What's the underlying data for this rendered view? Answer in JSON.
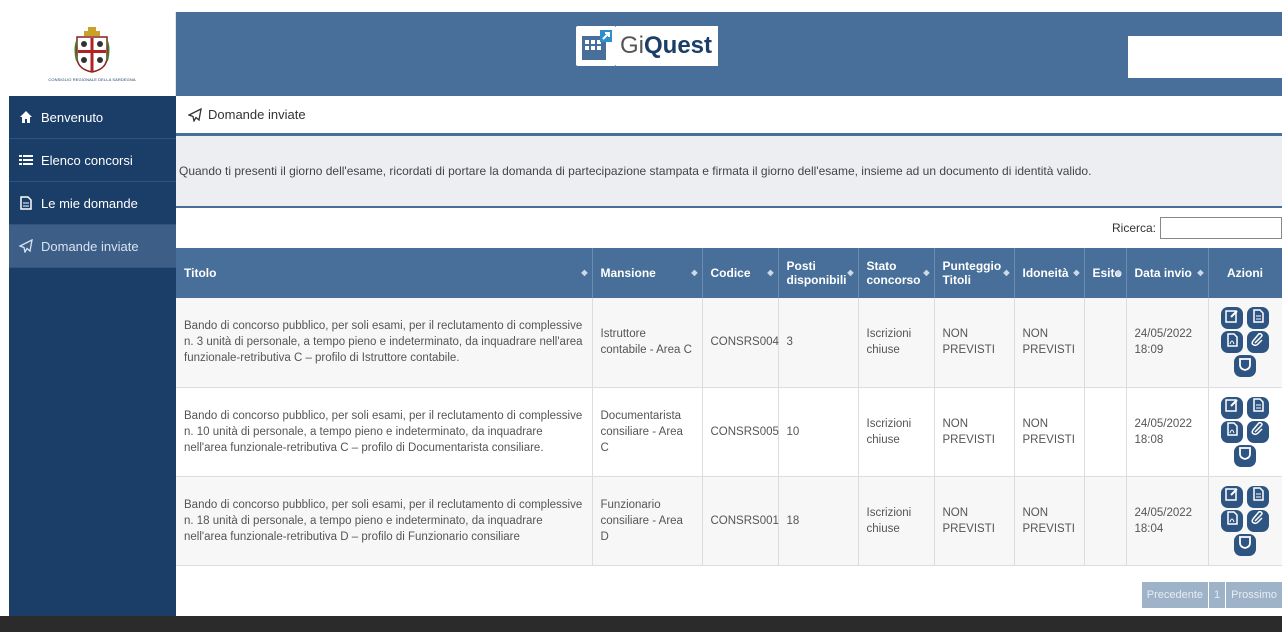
{
  "sidebar": {
    "logo_caption": "CONSIGLIO REGIONALE DELLA SARDEGNA",
    "items": [
      {
        "label": "Benvenuto",
        "icon": "home-icon"
      },
      {
        "label": "Elenco concorsi",
        "icon": "list-icon"
      },
      {
        "label": "Le mie domande",
        "icon": "document-icon"
      },
      {
        "label": "Domande inviate",
        "icon": "paper-plane-icon",
        "active": true
      }
    ]
  },
  "header": {
    "brand_light": "Gi",
    "brand_bold": "Quest"
  },
  "breadcrumb": {
    "label": "Domande inviate"
  },
  "notice": "Quando ti presenti il giorno dell'esame, ricordati di portare la domanda di partecipazione stampata e firmata il giorno dell'esame, insieme ad un documento di identità valido.",
  "search": {
    "label": "Ricerca:",
    "value": ""
  },
  "table": {
    "headers": [
      "Titolo",
      "Mansione",
      "Codice",
      "Posti disponibili",
      "Stato concorso",
      "Punteggio Titoli",
      "Idoneità",
      "Esito",
      "Data invio",
      "Azioni"
    ],
    "rows": [
      {
        "titolo": "Bando di concorso pubblico, per soli esami, per il reclutamento di complessive n. 3 unità di personale, a tempo pieno e indeterminato, da inquadrare nell'area funzionale-retributiva C – profilo di Istruttore contabile.",
        "mansione": "Istruttore contabile - Area C",
        "codice": "CONSRS004",
        "posti": "3",
        "stato": "Iscrizioni chiuse",
        "punteggio": "NON PREVISTI",
        "idoneita": "NON PREVISTI",
        "esito": "",
        "data": "24/05/2022 18:09"
      },
      {
        "titolo": "Bando di concorso pubblico, per soli esami, per il reclutamento di complessive n. 10 unità di personale, a tempo pieno e indeterminato, da inquadrare nell'area funzionale-retributiva C – profilo di Documentarista consiliare.",
        "mansione": "Documentarista consiliare - Area C",
        "codice": "CONSRS005",
        "posti": "10",
        "stato": "Iscrizioni chiuse",
        "punteggio": "NON PREVISTI",
        "idoneita": "NON PREVISTI",
        "esito": "",
        "data": "24/05/2022 18:08"
      },
      {
        "titolo": "Bando di concorso pubblico, per soli esami, per il reclutamento di complessive n. 18 unità di personale, a tempo pieno e indeterminato, da inquadrare nell'area funzionale-retributiva D – profilo di Funzionario consiliare",
        "mansione": "Funzionario consiliare - Area D",
        "codice": "CONSRS001",
        "posti": "18",
        "stato": "Iscrizioni chiuse",
        "punteggio": "NON PREVISTI",
        "idoneita": "NON PREVISTI",
        "esito": "",
        "data": "24/05/2022 18:04"
      }
    ]
  },
  "pager": {
    "prev": "Precedente",
    "page": "1",
    "next": "Prossimo"
  },
  "colors": {
    "sidebar": "#1a3e67",
    "header": "#476f99",
    "accent": "#2e5581"
  }
}
